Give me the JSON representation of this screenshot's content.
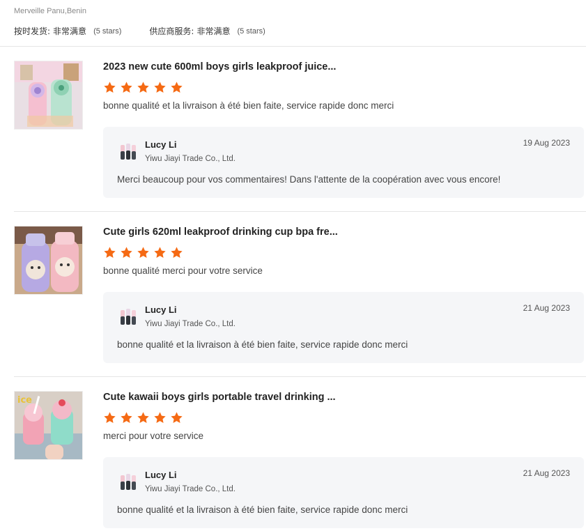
{
  "header": {
    "buyer_location": "Merveille Panu,Benin",
    "ratings": [
      {
        "label": "按时发货:",
        "value": "非常满意",
        "stars_text": "(5 stars)"
      },
      {
        "label": "供应商服务:",
        "value": "非常满意",
        "stars_text": "(5 stars)"
      }
    ]
  },
  "reviews": [
    {
      "product_title": "2023 new cute 600ml boys girls leakproof juice...",
      "rating": 5,
      "comment": "bonne qualité et la livraison à été bien faite, service rapide donc merci",
      "reply": {
        "name": "Lucy Li",
        "company": "Yiwu Jiayi Trade Co., Ltd.",
        "date": "19 Aug 2023",
        "text": "Merci beaucoup pour vos commentaires! Dans l'attente de la coopération avec vous encore!"
      }
    },
    {
      "product_title": "Cute girls 620ml leakproof drinking cup bpa fre...",
      "rating": 5,
      "comment": "bonne qualité merci pour votre service",
      "reply": {
        "name": "Lucy Li",
        "company": "Yiwu Jiayi Trade Co., Ltd.",
        "date": "21 Aug 2023",
        "text": "bonne qualité et la livraison à été bien faite, service rapide donc merci"
      }
    },
    {
      "product_title": "Cute kawaii boys girls portable travel drinking ...",
      "rating": 5,
      "comment": "merci pour votre service",
      "reply": {
        "name": "Lucy Li",
        "company": "Yiwu Jiayi Trade Co., Ltd.",
        "date": "21 Aug 2023",
        "text": "bonne qualité et la livraison à été bien faite, service rapide donc merci"
      }
    }
  ],
  "colors": {
    "star": "#f56a14",
    "reply_bg": "#f5f6f8",
    "divider": "#e5e5e5"
  },
  "icons": {
    "star": "star-icon",
    "avatar": "supplier-avatar-icon"
  }
}
